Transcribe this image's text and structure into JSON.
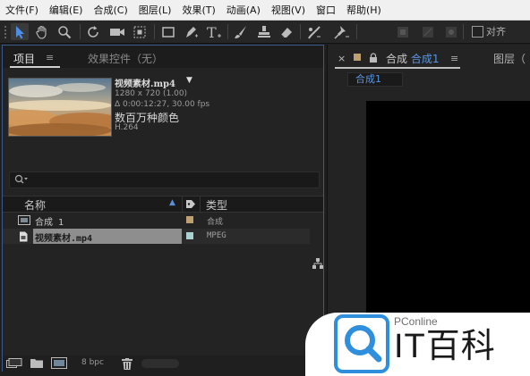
{
  "menu": [
    "文件(F)",
    "编辑(E)",
    "合成(C)",
    "图层(L)",
    "效果(T)",
    "动画(A)",
    "视图(V)",
    "窗口",
    "帮助(H)"
  ],
  "toolbar": {
    "snap_label": "对齐"
  },
  "project_panel": {
    "tab_active": "项目",
    "tab_inactive": "效果控件（无）",
    "tab_menu_glyph": "≡",
    "preview": {
      "filename": "视频素材.mp4",
      "arrow": "▼",
      "resolution": "1280 x 720 (1.00)",
      "duration": "Δ 0:00:12:27, 30.00 fps",
      "description": "数百万种颜色",
      "codec": "H.264"
    },
    "columns": {
      "name": "名称",
      "sort_glyph": "▲",
      "type": "类型"
    },
    "items": [
      {
        "name": "合成 1",
        "type": "合成",
        "label_color": "#bf9f72"
      },
      {
        "name": "视频素材.mp4",
        "type": "MPEG",
        "label_color": "#a9d3d3"
      }
    ],
    "bpc": "8 bpc"
  },
  "comp_panel": {
    "close_glyph": "×",
    "tab_prefix": "合成",
    "tab_name": "合成1",
    "menu_glyph": "≡",
    "layer_tab": "图层（",
    "chip_label": "合成1"
  },
  "watermark": {
    "sub": "PConline",
    "main": "IT百科"
  }
}
